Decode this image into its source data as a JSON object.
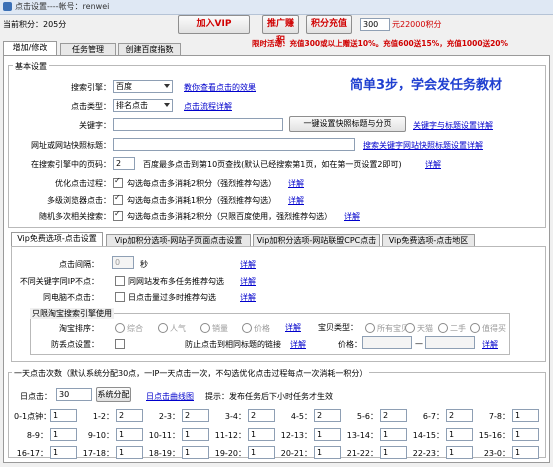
{
  "window": {
    "title": "点击设置----帐号：renwei"
  },
  "top": {
    "points": "当前积分：205分",
    "join_vip": "加入VIP",
    "promote": "推广赚积",
    "recharge": "积分充值",
    "recharge_amount": "300",
    "recharge_rate": "元22000积分",
    "promo": "限时活动：充值300或以上赠送10%。充值600送15%，充值1000送20%"
  },
  "main_tabs": [
    "增加/修改",
    "任务管理",
    "创建百度指数"
  ],
  "basic": {
    "group_title": "基本设置",
    "engine_label": "搜索引擎：",
    "engine_value": "百度",
    "engine_help": "教你查看点击的效果",
    "slogan": "简单3步，学会发任务教材",
    "click_type_label": "点击类型：",
    "click_type_value": "排名点击",
    "click_type_help": "点击流程详解",
    "keyword_label": "关键字：",
    "keyword_value": "",
    "set_title_btn": "一键设置快照标题与分页",
    "keyword_help": "关键字与标题设置详解",
    "url_label": "网址或网站快照标题：",
    "url_value": "",
    "url_help": "搜索关键字网站快照标题设置详解",
    "page_label": "在搜索引擎中的页码：",
    "page_value": "2",
    "page_desc": "百度最多点击到第10页查找(默认已经搜索第1页，如在第一页设置2即可)",
    "page_help": "详解",
    "opt1_label": "优化点击过程：",
    "opt1_text": "勾选每点击多消耗2积分（强烈推荐勾选）",
    "opt2_label": "多级浏览器点击：",
    "opt2_text": "勾选每点击多消耗1积分（强烈推荐勾选）",
    "opt3_label": "随机多次相关搜索：",
    "opt3_text": "勾选每点击多消耗2积分（只限百度使用，强烈推荐勾选）",
    "detail": "详解"
  },
  "sub_tabs": [
    "Vip免费选项-点击设置",
    "Vip加积分选项-网站子页面点击设置",
    "Vip加积分选项-网站联盟CPC点击",
    "Vip免费选项-点击地区"
  ],
  "vip": {
    "interval_label": "点击间隔：",
    "interval_value": "0",
    "interval_unit": "秒",
    "interval_help": "详解",
    "ipdiff_label": "不同关键字同IP不点：",
    "ipdiff_text": "同网站发布多任务推荐勾选",
    "ipdiff_help": "详解",
    "samepc_label": "同电脑不点击：",
    "samepc_text": "日点击量过多时推荐勾选",
    "samepc_help": "详解",
    "taobao_title": "只限淘宝搜索引擎使用",
    "sort_label": "淘宝排序：",
    "sort_options": [
      "综合",
      "人气",
      "销量",
      "价格"
    ],
    "sort_help": "详解",
    "baobei_label": "宝贝类型：",
    "baobei_options": [
      "所有宝贝",
      "天猫",
      "二手",
      "值得买"
    ],
    "anti_label": "防丢点设置：",
    "anti_text": "防止点击到相同标题的链接",
    "anti_help": "详解",
    "price_label": "价格：",
    "price_sep": "—",
    "price_help": "详解"
  },
  "daily": {
    "title": "一天点击次数（默认系统分配30点，一IP一天点击一次，不勾选优化点击过程每点一次消耗一积分）",
    "label": "日点击：",
    "value": "30",
    "alloc_btn": "系统分配",
    "curve_link": "日点击曲线图",
    "tip": "提示：发布任务后下小时任务才生效",
    "hours": [
      {
        "l": "0-1点钟：",
        "v": "1"
      },
      {
        "l": "1-2：",
        "v": "2"
      },
      {
        "l": "2-3：",
        "v": "2"
      },
      {
        "l": "3-4：",
        "v": "2"
      },
      {
        "l": "4-5：",
        "v": "2"
      },
      {
        "l": "5-6：",
        "v": "2"
      },
      {
        "l": "6-7：",
        "v": "2"
      },
      {
        "l": "7-8：",
        "v": "1"
      },
      {
        "l": "8-9：",
        "v": "1"
      },
      {
        "l": "9-10：",
        "v": "1"
      },
      {
        "l": "10-11：",
        "v": "1"
      },
      {
        "l": "11-12：",
        "v": "1"
      },
      {
        "l": "12-13：",
        "v": "1"
      },
      {
        "l": "13-14：",
        "v": "1"
      },
      {
        "l": "14-15：",
        "v": "1"
      },
      {
        "l": "15-16：",
        "v": "1"
      },
      {
        "l": "16-17：",
        "v": "1"
      },
      {
        "l": "17-18：",
        "v": "1"
      },
      {
        "l": "18-19：",
        "v": "1"
      },
      {
        "l": "19-20：",
        "v": "1"
      },
      {
        "l": "20-21：",
        "v": "1"
      },
      {
        "l": "21-22：",
        "v": "1"
      },
      {
        "l": "22-23：",
        "v": "1"
      },
      {
        "l": "23-0：",
        "v": "1"
      }
    ]
  }
}
